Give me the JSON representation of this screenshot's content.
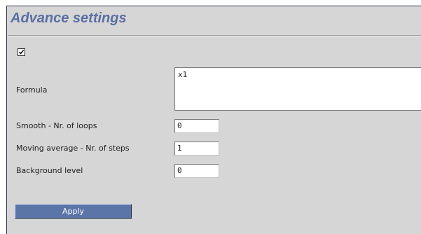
{
  "panel": {
    "title": "Advance settings"
  },
  "enable_checkbox": {
    "checked": true
  },
  "form": {
    "formula": {
      "label": "Formula",
      "value": "x1"
    },
    "smooth": {
      "label": "Smooth - Nr. of loops",
      "value": "0"
    },
    "moving_average": {
      "label": "Moving average - Nr. of steps",
      "value": "1"
    },
    "background": {
      "label": "Background level",
      "value": "0"
    }
  },
  "actions": {
    "apply_label": "Apply"
  },
  "colors": {
    "panel_bg": "#d6d6d6",
    "title": "#5a6fa3",
    "button_bg": "#5c75a8"
  }
}
